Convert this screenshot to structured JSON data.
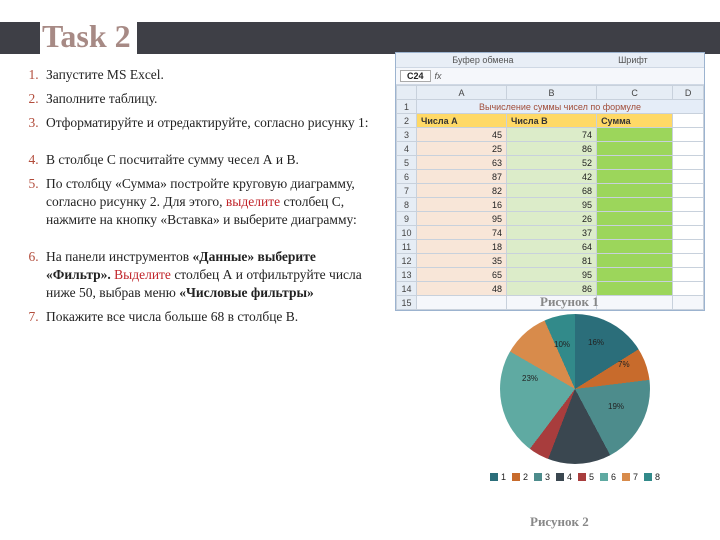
{
  "title": "Task 2",
  "list": {
    "i1": "Запустите MS Excel.",
    "i2": "Заполните таблицу.",
    "i3": " Отформатируйте и отредактируйте, согласно рисунку 1:",
    "i4": "В столбце С посчитайте сумму чесел А и В.",
    "i5a": "По столбцу «Сумма» постройте круговую диаграмму, согласно рисунку 2. Для этого, ",
    "i5b": "выделите",
    "i5c": " столбец С, нажмите на кнопку «Вставка» и выберите диаграмму:",
    "i6a": "На панели инструментов ",
    "i6b": "«Данные» выберите «Фильтр». ",
    "i6c": "Выделите",
    "i6d": " столбец А и отфильтруйте числа ниже 50, выбрав меню  ",
    "i6e": "«Числовые фильтры»",
    "i7": "Покажите все числа больше 68 в столбце В."
  },
  "excel": {
    "ribbon1": "Буфер обмена",
    "ribbon2": "Шрифт",
    "namebox": "C24",
    "fx": "fx",
    "merged": "Вычисление суммы чисел по формуле",
    "colA": "A",
    "colB": "B",
    "colC": "C",
    "colD": "D",
    "h1": "Числа А",
    "h2": "Числа В",
    "h3": "Сумма",
    "rows": [
      {
        "n": "1"
      },
      {
        "n": "2"
      },
      {
        "n": "3",
        "a": "45",
        "b": "74"
      },
      {
        "n": "4",
        "a": "25",
        "b": "86"
      },
      {
        "n": "5",
        "a": "63",
        "b": "52"
      },
      {
        "n": "6",
        "a": "87",
        "b": "42"
      },
      {
        "n": "7",
        "a": "82",
        "b": "68"
      },
      {
        "n": "8",
        "a": "16",
        "b": "95"
      },
      {
        "n": "9",
        "a": "95",
        "b": "26"
      },
      {
        "n": "10",
        "a": "74",
        "b": "37"
      },
      {
        "n": "11",
        "a": "18",
        "b": "64"
      },
      {
        "n": "12",
        "a": "35",
        "b": "81"
      },
      {
        "n": "13",
        "a": "65",
        "b": "95"
      },
      {
        "n": "14",
        "a": "48",
        "b": "86"
      },
      {
        "n": "15"
      }
    ]
  },
  "fig1": "Рисунок 1",
  "fig2": "Рисунок 2",
  "chart_data": {
    "type": "pie",
    "series": [
      {
        "name": "1",
        "value": 16,
        "color": "#2b6e7a"
      },
      {
        "name": "2",
        "value": 7,
        "color": "#c86b2c"
      },
      {
        "name": "3",
        "value": 19,
        "color": "#4d8c8c"
      },
      {
        "name": "4",
        "value": 14,
        "color": "#3a4750"
      },
      {
        "name": "5",
        "value": 4,
        "color": "#a83d3d"
      },
      {
        "name": "6",
        "value": 23,
        "color": "#5faaa2"
      },
      {
        "name": "7",
        "value": 10,
        "color": "#d88b4b"
      },
      {
        "name": "8",
        "value": 7,
        "color": "#328a8a"
      }
    ],
    "labels": {
      "p1": "16%",
      "p2": "7%",
      "p3": "19%",
      "p6": "23%",
      "p7": "10%"
    }
  },
  "legend": {
    "l1": "1",
    "l2": "2",
    "l3": "3",
    "l4": "4",
    "l5": "5",
    "l6": "6",
    "l7": "7",
    "l8": "8"
  }
}
